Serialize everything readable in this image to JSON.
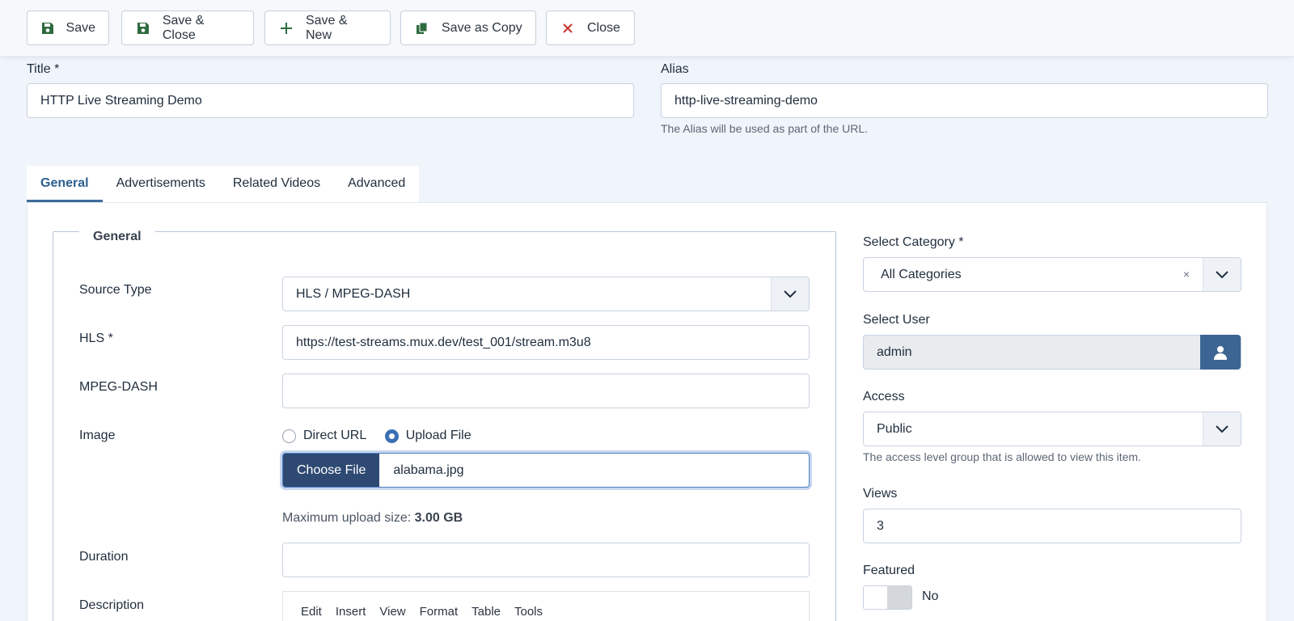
{
  "toolbar": {
    "save": "Save",
    "save_close": "Save & Close",
    "save_new": "Save & New",
    "save_copy": "Save as Copy",
    "close": "Close"
  },
  "header": {
    "title_label": "Title *",
    "title_value": "HTTP Live Streaming Demo",
    "alias_label": "Alias",
    "alias_value": "http-live-streaming-demo",
    "alias_help": "The Alias will be used as part of the URL."
  },
  "tabs": [
    {
      "label": "General"
    },
    {
      "label": "Advertisements"
    },
    {
      "label": "Related Videos"
    },
    {
      "label": "Advanced"
    }
  ],
  "general": {
    "legend": "General",
    "source_type_label": "Source Type",
    "source_type_value": "HLS / MPEG-DASH",
    "hls_label": "HLS *",
    "hls_value": "https://test-streams.mux.dev/test_001/stream.m3u8",
    "dash_label": "MPEG-DASH",
    "dash_value": "",
    "image_label": "Image",
    "image_options": [
      "Direct URL",
      "Upload File"
    ],
    "image_selected": "Upload File",
    "choose_file": "Choose File",
    "file_name": "alabama.jpg",
    "max_upload_prefix": "Maximum upload size:",
    "max_upload_value": "3.00 GB",
    "duration_label": "Duration",
    "duration_value": "",
    "description_label": "Description",
    "editor_menu": [
      "Edit",
      "Insert",
      "View",
      "Format",
      "Table",
      "Tools"
    ]
  },
  "sidebar": {
    "category_label": "Select Category *",
    "category_value": "All Categories",
    "user_label": "Select User",
    "user_value": "admin",
    "access_label": "Access",
    "access_value": "Public",
    "access_help": "The access level group that is allowed to view this item.",
    "views_label": "Views",
    "views_value": "3",
    "featured_label": "Featured",
    "featured_value": "No"
  },
  "colors": {
    "accent": "#3d6593",
    "save_icon": "#2e6b3e",
    "close_icon": "#c9302c"
  }
}
